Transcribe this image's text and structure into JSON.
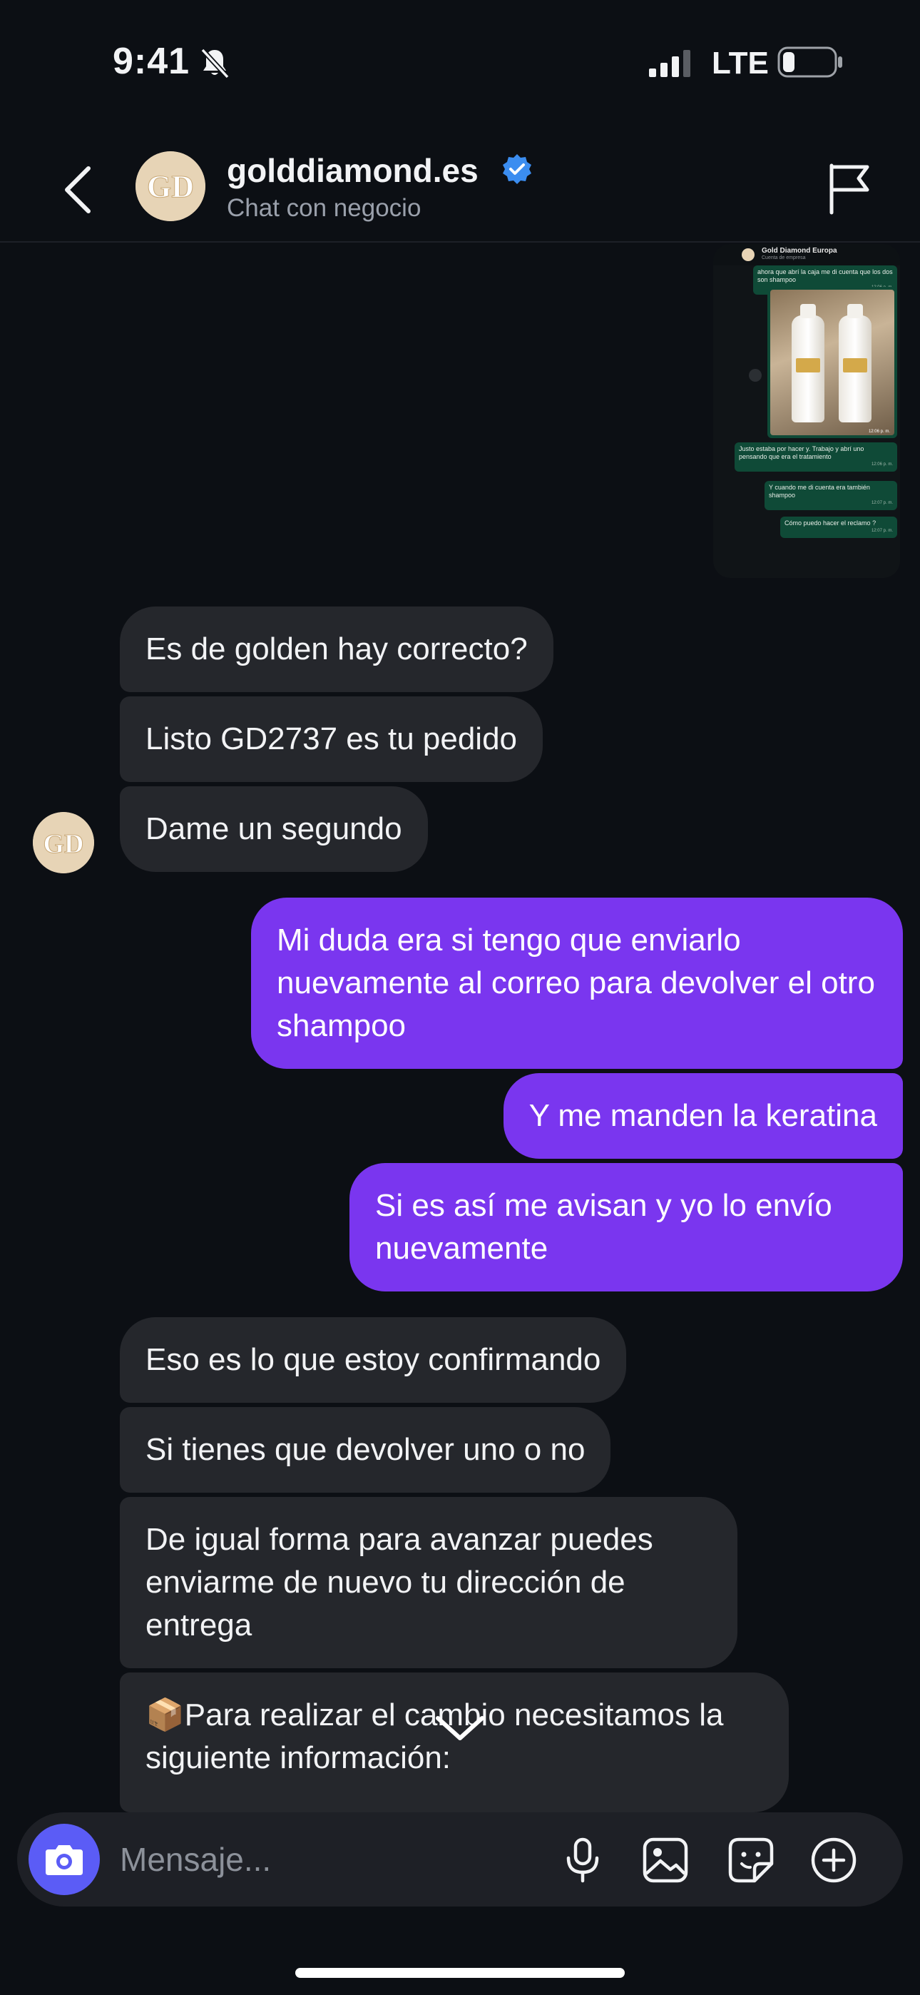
{
  "status_bar": {
    "time": "9:41",
    "network": "LTE"
  },
  "header": {
    "name": "golddiamond.es",
    "subtitle": "Chat con negocio",
    "avatar_initials": "GD"
  },
  "attachment": {
    "chat_title": "Gold Diamond Europa",
    "chat_subtitle": "Cuenta de empresa",
    "messages": [
      {
        "text": "ahora que abrí la caja me di cuenta que los dos son shampoo",
        "time": "12:06 p. m."
      },
      {
        "text": "Justo estaba por hacer y. Trabajo y abrí uno pensando que era el tratamiento",
        "time": "12:06 p. m."
      },
      {
        "text": "Y cuando me di cuenta era también shampoo",
        "time": "12:07 p. m."
      },
      {
        "text": "Cómo puedo hacer el reclamo ?",
        "time": "12:07 p. m."
      }
    ],
    "photo_time": "12:06 p. m."
  },
  "messages": [
    {
      "id": "m1",
      "text": "Es de golden hay correcto?"
    },
    {
      "id": "m2",
      "text": "Listo GD2737 es tu pedido"
    },
    {
      "id": "m3",
      "text": "Dame un segundo"
    },
    {
      "id": "m4",
      "text": "Mi duda era si tengo que enviarlo nuevamente al correo para devolver el otro shampoo"
    },
    {
      "id": "m5",
      "text": "Y me manden la keratina"
    },
    {
      "id": "m6",
      "text": "Si es así me avisan y yo lo envío nuevamente"
    },
    {
      "id": "m7",
      "text": "Eso es lo que estoy confirmando"
    },
    {
      "id": "m8",
      "text": "Si tienes que devolver uno o no"
    },
    {
      "id": "m9",
      "text": "De igual forma para avanzar puedes enviarme de nuevo tu dirección de entrega"
    },
    {
      "id": "m10",
      "text": "📦Para realizar el cambio necesitamos la siguiente información:"
    }
  ],
  "composer": {
    "placeholder": "Mensaje..."
  },
  "colors": {
    "background": "#0c0f14",
    "incoming_bubble": "#25272c",
    "outgoing_bubble": "#7a36ef",
    "camera_button": "#5b5cf6",
    "verified_badge": "#3b8df0",
    "whatsapp_bubble": "#0f4a37"
  },
  "icons": [
    "bell-slash-icon",
    "signal-icon",
    "battery-icon",
    "back-chevron-icon",
    "verified-badge-icon",
    "flag-icon",
    "camera-icon",
    "microphone-icon",
    "image-icon",
    "sticker-icon",
    "plus-circle-icon",
    "chevron-down-icon"
  ]
}
